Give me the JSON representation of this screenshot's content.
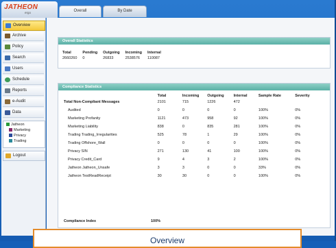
{
  "logo": {
    "brand": "JATHEON",
    "sub": "ergo"
  },
  "tabs": [
    "Overall",
    "By Date"
  ],
  "sidebar": {
    "items": [
      {
        "label": "Overview",
        "icon": "overview-icon",
        "color": "#3b7bd4",
        "active": true
      },
      {
        "label": "Archive",
        "icon": "archive-icon",
        "color": "#7a5a2e"
      },
      {
        "label": "Policy",
        "icon": "policy-icon",
        "color": "#5a8a3c"
      },
      {
        "label": "Search",
        "icon": "search-icon",
        "color": "#3a6aaa"
      },
      {
        "label": "Users",
        "icon": "users-icon",
        "color": "#4a7ac4"
      },
      {
        "label": "Schedule",
        "icon": "schedule-icon",
        "color": "#3e9a5a"
      },
      {
        "label": "Reports",
        "icon": "reports-icon",
        "color": "#6a7a8a"
      },
      {
        "label": "e-Audit",
        "icon": "audit-icon",
        "color": "#8a6a3a"
      },
      {
        "label": "Data",
        "icon": "data-icon",
        "color": "#3a5a9a"
      }
    ],
    "groups": [
      {
        "label": "Jatheon",
        "color": "#2a9a3a"
      },
      {
        "label": "Marketing",
        "color": "#8a2a6a"
      },
      {
        "label": "Privacy",
        "color": "#2a4a9a"
      },
      {
        "label": "Trading",
        "color": "#2a8a9a"
      }
    ],
    "logout": "Logout"
  },
  "summary": {
    "title": "Overall Statistics",
    "headers": [
      "Total",
      "Pending",
      "Outgoing",
      "Incoming",
      "Internal"
    ],
    "values": [
      "2660260",
      "0",
      "26833",
      "2538576",
      "110087"
    ]
  },
  "compliance": {
    "title": "Compliance Statistics",
    "headers": [
      "",
      "Total",
      "Incoming",
      "Outgoing",
      "Internal",
      "Sample Rate",
      "Severity"
    ],
    "rows": [
      [
        "Total Non-Compliant Messages",
        "2101",
        "715",
        "1226",
        "472",
        "",
        ""
      ],
      [
        "Audited",
        "0",
        "0",
        "0",
        "0",
        "100%",
        "0%"
      ],
      [
        "Marketing Profanity",
        "1121",
        "473",
        "958",
        "92",
        "100%",
        "0%"
      ],
      [
        "Marketing Liability",
        "838",
        "0",
        "835",
        "281",
        "100%",
        "0%"
      ],
      [
        "Trading Trading_Irregularities",
        "525",
        "78",
        "1",
        "29",
        "100%",
        "0%"
      ],
      [
        "Trading Offshore_Wall",
        "0",
        "0",
        "0",
        "0",
        "100%",
        "0%"
      ],
      [
        "Privacy SIN",
        "271",
        "130",
        "41",
        "100",
        "100%",
        "0%"
      ],
      [
        "Privacy Credit_Card",
        "9",
        "4",
        "3",
        "2",
        "100%",
        "0%"
      ],
      [
        "Jatheon Jatheon_Unsafe",
        "3",
        "3",
        "0",
        "0",
        "33%",
        "0%"
      ],
      [
        "Jatheon TestReadReceipt",
        "30",
        "30",
        "0",
        "0",
        "100%",
        "0%"
      ]
    ],
    "index_label": "Compliance Index",
    "index_value": "100%"
  },
  "caption": "Overview"
}
